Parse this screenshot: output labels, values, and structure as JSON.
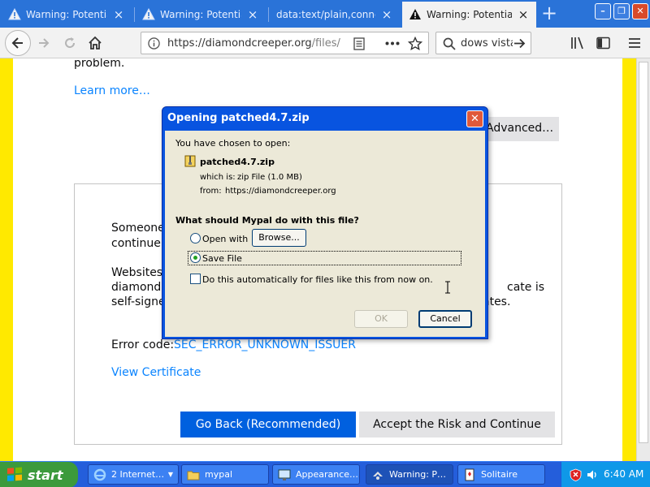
{
  "browser": {
    "tabs": [
      {
        "label": "Warning: Potential Se",
        "active": false,
        "warning": true
      },
      {
        "label": "Warning: Potential Se",
        "active": false,
        "warning": true
      },
      {
        "label": "data:text/plain,connectio",
        "active": false,
        "warning": false
      },
      {
        "label": "Warning: Potential Se",
        "active": true,
        "warning": true
      }
    ],
    "url": {
      "main": "https://diamondcreeper.org",
      "dim": "/files/"
    },
    "search_text": "dows vista"
  },
  "page": {
    "problem_text": "problem.",
    "learn_more": "Learn more…",
    "advanced_button": "Advanced…",
    "details": {
      "line1": "Someone",
      "line2": "continue.",
      "line3": "Websites",
      "line4": "diamondc",
      "line4_right": "cate is",
      "line5": "self-signe",
      "line5_right": "ates.",
      "error_code_label": "Error code:",
      "error_code": "SEC_ERROR_UNKNOWN_ISSUER",
      "view_certificate": "View Certificate"
    },
    "go_back_button": "Go Back (Recommended)",
    "accept_button": "Accept the Risk and Continue"
  },
  "dialog": {
    "title": "Opening patched4.7.zip",
    "chosen_text": "You have chosen to open:",
    "filename": "patched4.7.zip",
    "which_is_label": "which is:",
    "which_is_value": "zip File (1.0 MB)",
    "from_label": "from:",
    "from_value": "https://diamondcreeper.org",
    "question": "What should Mypal do with this file?",
    "open_with_label": "Open with",
    "browse_button": "Browse...",
    "save_file_label": "Save File",
    "auto_checkbox_label": "Do this automatically for files like this from now on.",
    "ok_button": "OK",
    "cancel_button": "Cancel",
    "selected_option": "save_file"
  },
  "taskbar": {
    "start_label": "start",
    "items": [
      {
        "label": "2 Internet…",
        "icon": "internet-explorer-icon",
        "active": false
      },
      {
        "label": "mypal",
        "icon": "folder-icon",
        "active": false
      },
      {
        "label": "Appearance…",
        "icon": "display-properties-icon",
        "active": false
      },
      {
        "label": "Warning: P…",
        "icon": "mypal-browser-icon",
        "active": true
      },
      {
        "label": "Solitaire",
        "icon": "solitaire-icon",
        "active": false
      }
    ],
    "clock": "6:40 AM"
  },
  "colors": {
    "titlebar_blue": "#2a73d8",
    "warning_yellow": "#ffe900",
    "link_blue": "#0a84ff",
    "primary_button": "#0060df",
    "xp_dialog_bg": "#ece9d8",
    "xp_title_blue": "#0854e0",
    "taskbar_blue": "#245edb",
    "start_green": "#3c9a3c"
  }
}
